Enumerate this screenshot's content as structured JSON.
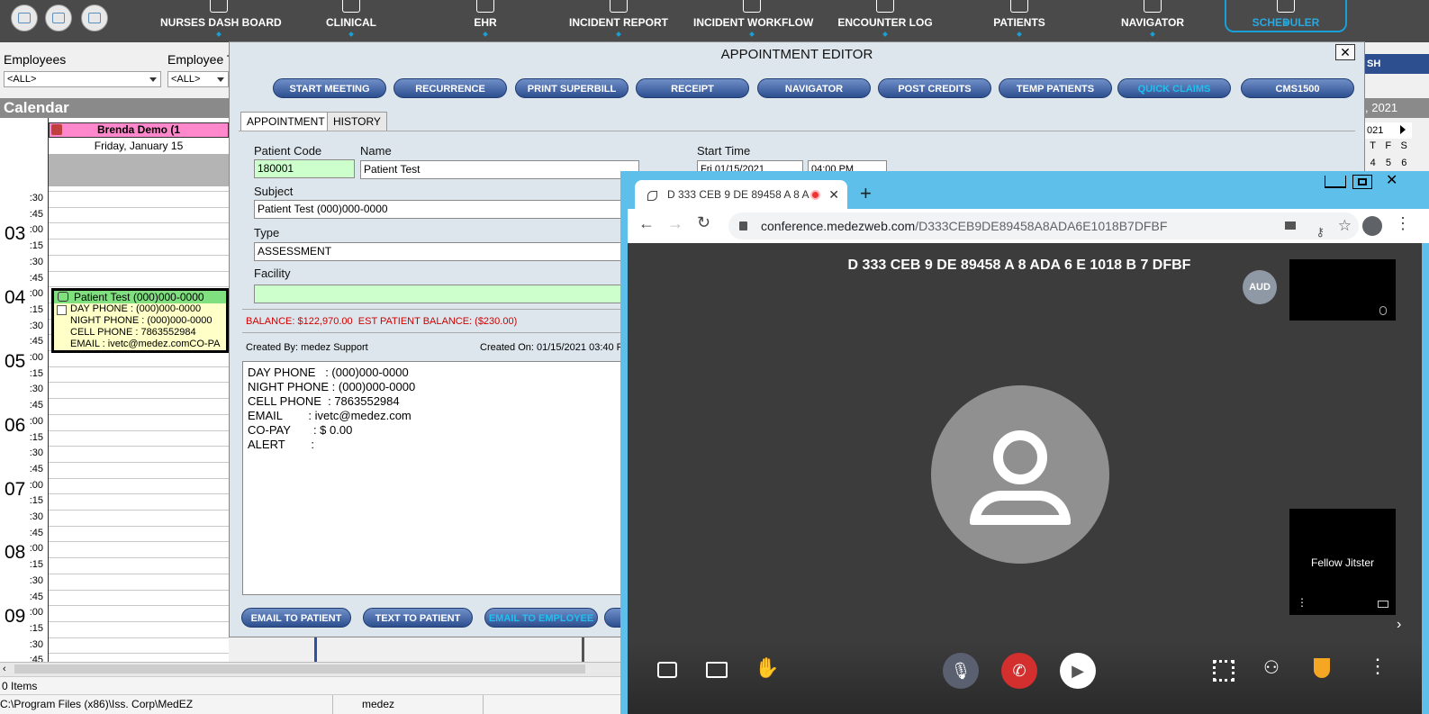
{
  "nav": {
    "items": [
      "NURSES DASH BOARD",
      "CLINICAL",
      "EHR",
      "INCIDENT REPORT",
      "INCIDENT WORKFLOW",
      "ENCOUNTER LOG",
      "PATIENTS",
      "NAVIGATOR",
      "SCHEDULER"
    ],
    "active": "SCHEDULER"
  },
  "filters": {
    "employees_label": "Employees",
    "employees_value": "<ALL>",
    "employee_type_label": "Employee T",
    "employee_type_value": "<ALL>"
  },
  "calendar": {
    "title": "Calendar",
    "provider": "Brenda Demo (1",
    "date": "Friday, January 15",
    "hours": [
      "03",
      "04",
      "05",
      "06",
      "07",
      "08",
      "09"
    ],
    "minute_labels": [
      ":30",
      ":45",
      ":00",
      ":15",
      ":30",
      ":45",
      ":00",
      ":15",
      ":30",
      ":45"
    ],
    "items_count": "0 Items",
    "path": "C:\\Program Files (x86)\\Iss. Corp\\MedEZ",
    "user": "medez"
  },
  "appointment_block": {
    "header": "Patient Test  (000)000-0000",
    "lines": [
      "DAY PHONE   : (000)000-0000",
      "NIGHT PHONE : (000)000-0000",
      "CELL PHONE  : 7863552984",
      "EMAIL       : ivetc@medez.comCO-PA"
    ]
  },
  "right_calendar": {
    "year": ", 2021",
    "month_year": "021",
    "days_header": [
      "T",
      "F",
      "S"
    ],
    "days": [
      "4",
      "5",
      "6"
    ]
  },
  "editor": {
    "title": "APPOINTMENT EDITOR",
    "close": "✕",
    "buttons": [
      "START MEETING",
      "RECURRENCE",
      "PRINT SUPERBILL",
      "RECEIPT",
      "NAVIGATOR",
      "POST CREDITS",
      "TEMP PATIENTS",
      "QUICK CLAIMS",
      "CMS1500"
    ],
    "tabs": [
      "APPOINTMENT",
      "HISTORY"
    ],
    "patient_code_label": "Patient Code",
    "patient_code": "180001",
    "name_label": "Name",
    "name": "Patient Test",
    "subject_label": "Subject",
    "subject": "Patient Test  (000)000-0000",
    "type_label": "Type",
    "type": "ASSESSMENT",
    "facility_label": "Facility",
    "facility": "",
    "start_time_label": "Start Time",
    "start_date": "Fri  01/15/2021",
    "start_time": "04:00 PM",
    "balance": "BALANCE: $122,970.00",
    "est_balance": "EST PATIENT BALANCE: ($230.00)",
    "created_by": "Created By: medez Support",
    "created_on": "Created On: 01/15/2021 03:40 P",
    "notes": "DAY PHONE   : (000)000-0000\nNIGHT PHONE : (000)000-0000\nCELL PHONE  : 7863552984\nEMAIL        : ivetc@medez.com\nCO-PAY       : $ 0.00\nALERT        :",
    "bottom_buttons": [
      "EMAIL TO PATIENT",
      "TEXT TO PATIENT",
      "EMAIL TO EMPLOYEE"
    ],
    "top_right_fragment": "SH"
  },
  "browser": {
    "tab_title": "D 333 CEB 9 DE 89458 A 8 A",
    "url_domain": "conference.medezweb.com",
    "url_path": "/D333CEB9DE89458A8ADA6E1018B7DFBF",
    "new_tab": "+",
    "tab_close": "✕"
  },
  "meeting": {
    "title": "D 333 CEB 9 DE 89458 A 8 ADA 6 E 1018 B 7 DFBF",
    "aud_badge": "AUD",
    "participant_name": "Fellow Jitster"
  },
  "colors": {
    "nav_bg": "#4a4a4a",
    "accent": "#18a0d8",
    "provider_pink": "#ff88cc",
    "appt_green": "#80e080",
    "balance_red": "#d00000",
    "browser_frame": "#5ec0ea",
    "hangup_red": "#d32f2f"
  }
}
